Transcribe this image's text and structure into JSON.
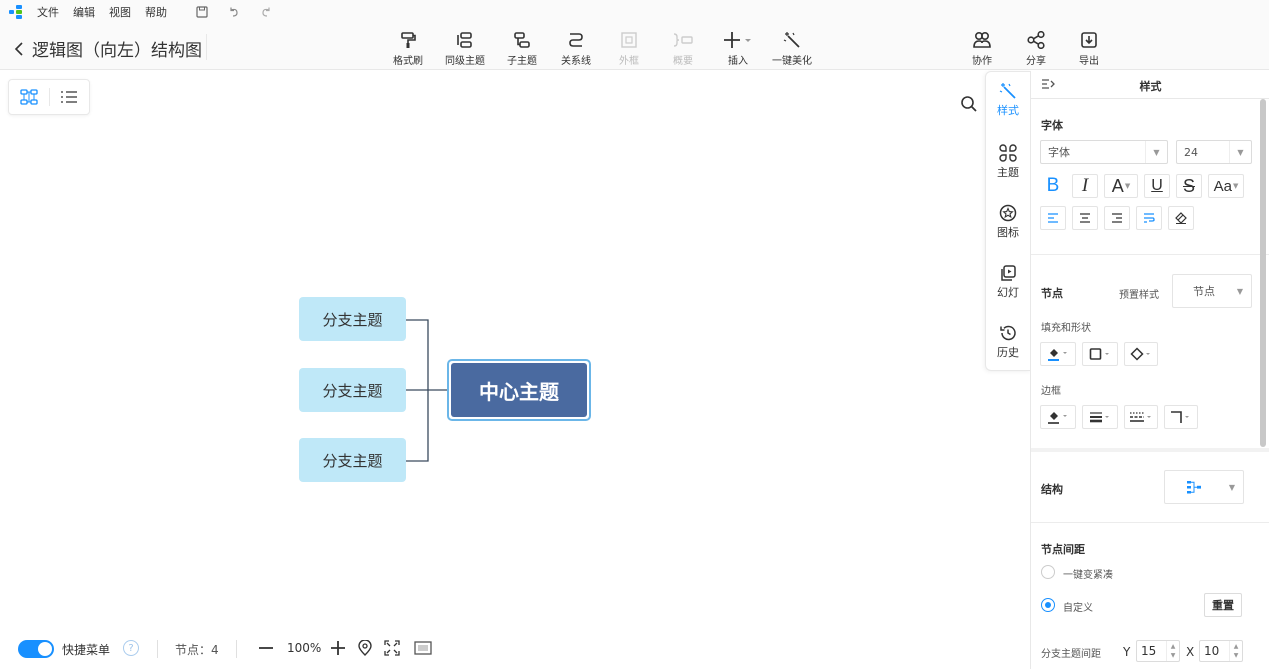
{
  "menubar": {
    "items": [
      "文件",
      "编辑",
      "视图",
      "帮助"
    ]
  },
  "toolbar": {
    "title": "逻辑图（向左）结构图",
    "tools": {
      "format_brush": "格式刷",
      "sibling_topic": "同级主题",
      "child_topic": "子主题",
      "relation_line": "关系线",
      "frame": "外框",
      "summary": "概要",
      "insert": "插入",
      "beautify": "一键美化"
    },
    "right": {
      "collaborate": "协作",
      "share": "分享",
      "export": "导出"
    }
  },
  "mindmap": {
    "center": "中心主题",
    "branches": [
      "分支主题",
      "分支主题",
      "分支主题"
    ]
  },
  "status": {
    "quick_menu": "快捷菜单",
    "help": "?",
    "nodes_label": "节点：4",
    "zoom": "100%"
  },
  "rail": {
    "style": "样式",
    "theme": "主题",
    "icon": "图标",
    "slides": "幻灯",
    "history": "历史"
  },
  "panel": {
    "title": "样式",
    "font_section": "字体",
    "font_family": "字体",
    "font_size": "24",
    "node_section": "节点",
    "preset_label": "预置样式",
    "preset_value": "节点",
    "fill_label": "填充和形状",
    "border_label": "边框",
    "structure_section": "结构",
    "spacing_section": "节点间距",
    "compact_option": "一键变紧凑",
    "custom_option": "自定义",
    "reset_button": "重置",
    "branch_spacing_label": "分支主题间距",
    "y_label": "Y",
    "y_value": "15",
    "x_label": "X",
    "x_value": "10"
  },
  "colors": {
    "accent": "#1890ff",
    "center_fill": "#4a6aa0",
    "branch_fill": "#bfe8f8",
    "selection": "#6bb6e8"
  }
}
